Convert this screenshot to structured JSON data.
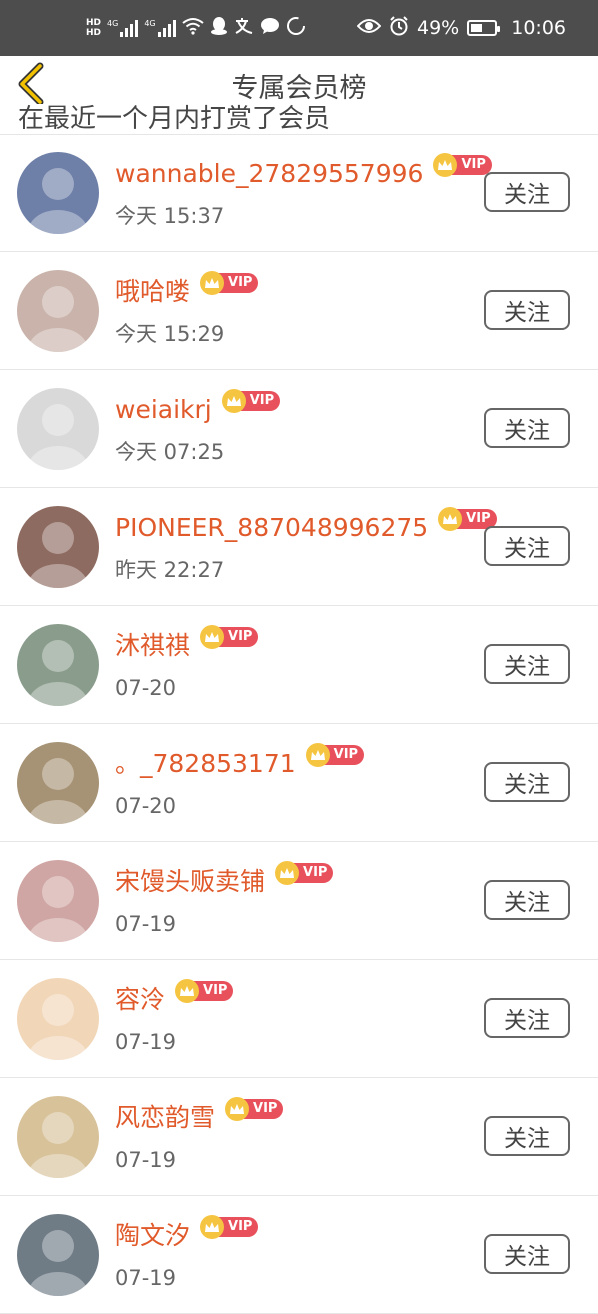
{
  "status_bar": {
    "hd1": "HD",
    "hd2": "HD",
    "net1": "4G",
    "net2": "4G",
    "battery_percent": "49%",
    "battery_level": 0.49,
    "time": "10:06"
  },
  "header": {
    "title": "专属会员榜",
    "scrolled_peek_text": "在最近一个月内打赏了会员",
    "back_icon": "chevron-left-icon"
  },
  "vip_label": "VIP",
  "follow_label": "关注",
  "members": [
    {
      "name": "wannable_27829557996",
      "time": "今天 15:37",
      "avatar_color": "#6e7fa8"
    },
    {
      "name": "哦哈喽",
      "time": "今天 15:29",
      "avatar_color": "#c9b3ab"
    },
    {
      "name": "weiaikrj",
      "time": "今天 07:25",
      "avatar_color": "#d9d9d9"
    },
    {
      "name": "PIONEER_887048996275",
      "time": "昨天 22:27",
      "avatar_color": "#8e6b60"
    },
    {
      "name": "沐祺祺",
      "time": "07-20",
      "avatar_color": "#8a9d8c"
    },
    {
      "name": "。_782853171",
      "time": "07-20",
      "avatar_color": "#a69274"
    },
    {
      "name": "宋馒头贩卖铺",
      "time": "07-19",
      "avatar_color": "#cfa6a3"
    },
    {
      "name": "容泠",
      "time": "07-19",
      "avatar_color": "#f1d6b8"
    },
    {
      "name": "风恋韵雪",
      "time": "07-19",
      "avatar_color": "#d8c29a"
    },
    {
      "name": "陶文汐",
      "time": "07-19",
      "avatar_color": "#6f7c86"
    }
  ]
}
